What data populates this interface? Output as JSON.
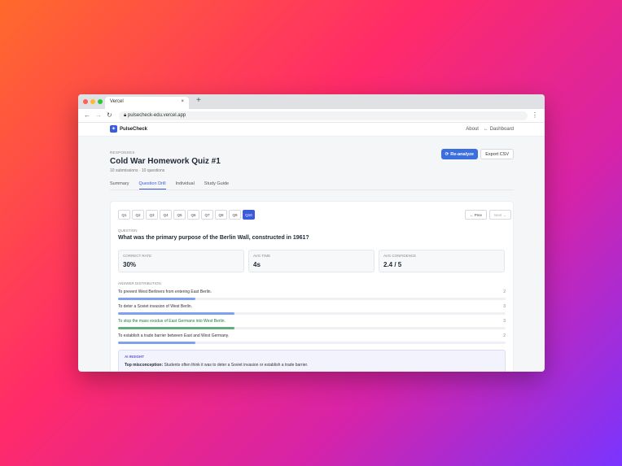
{
  "browser": {
    "tab_title": "Vercel",
    "tab_close": "×",
    "new_tab": "+",
    "url": "pulsecheck-edu.vercel.app",
    "dot_colors": [
      "#ff5f57",
      "#febc2e",
      "#28c840"
    ]
  },
  "app": {
    "brand": "PulseCheck",
    "links": [
      "About",
      "← Dashboard"
    ]
  },
  "page": {
    "eyebrow": "RESPONSES",
    "title": "Cold War Homework Quiz #1",
    "subtitle": "10 submissions · 10 questions",
    "reanalyze_label": "Re-analyze",
    "export_label": "Export CSV"
  },
  "tabs": [
    "Summary",
    "Question Drill",
    "Individual",
    "Study Guide"
  ],
  "drill": {
    "questions": [
      "Q1",
      "Q2",
      "Q3",
      "Q4",
      "Q5",
      "Q6",
      "Q7",
      "Q8",
      "Q9",
      "Q10"
    ],
    "selected": "Q10",
    "prev_label": "← Prev",
    "next_label": "Next →",
    "question_label": "QUESTION",
    "question_text": "What was the primary purpose of the Berlin Wall, constructed in 1961?",
    "stats": [
      {
        "label": "CORRECT RATE",
        "value": "30%"
      },
      {
        "label": "AVG TIME",
        "value": "4s"
      },
      {
        "label": "AVG CONFIDENCE",
        "value": "2.4 / 5"
      }
    ],
    "distribution_label": "ANSWER DISTRIBUTION",
    "answers": [
      {
        "text": "To prevent West Berliners from entering East Berlin.",
        "count": "2",
        "fraction": 0.2,
        "correct": false
      },
      {
        "text": "To deter a Soviet invasion of West Berlin.",
        "count": "3",
        "fraction": 0.3,
        "correct": false
      },
      {
        "text": "To stop the mass exodus of East Germans into West Berlin.",
        "count": "3",
        "fraction": 0.3,
        "correct": true
      },
      {
        "text": "To establish a trade barrier between East and West Germany.",
        "count": "2",
        "fraction": 0.2,
        "correct": false
      }
    ],
    "insight_label": "AI INSIGHT",
    "insight_prefix": "Top misconception:",
    "insight_text": "Students often think it was to deter a Soviet invasion or establish a trade barrier."
  },
  "colors": {
    "accent": "#3b5bdb",
    "bar": "#7ea2ef",
    "correct_bar": "#5fae7a"
  }
}
